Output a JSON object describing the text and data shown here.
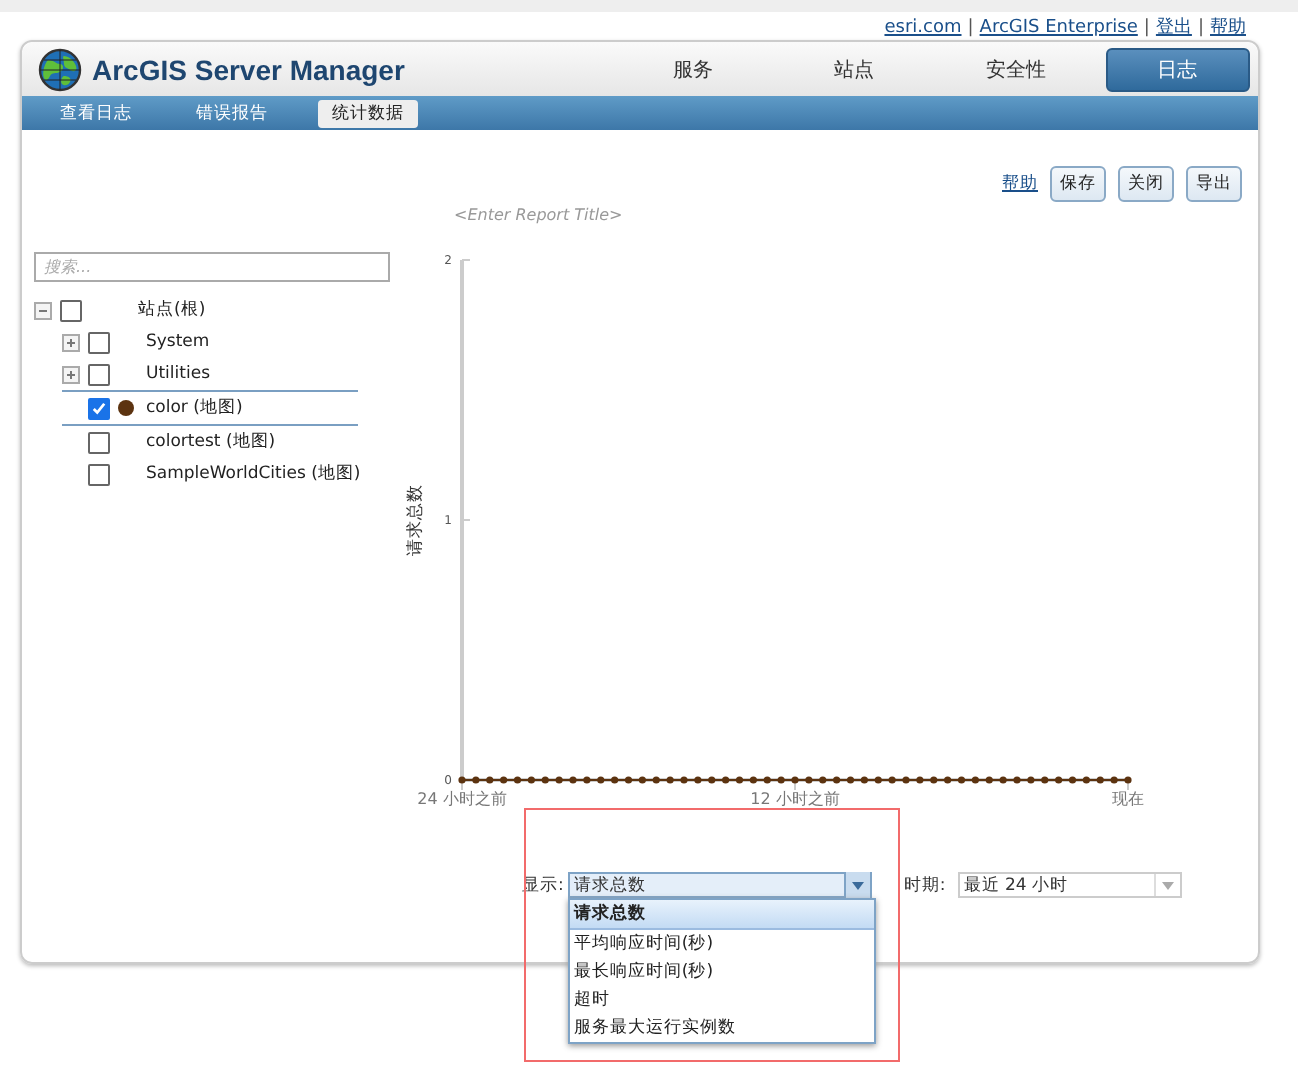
{
  "top_links": [
    "esri.com",
    "ArcGIS Enterprise",
    "登出",
    "帮助"
  ],
  "top_link_separators": [
    "|",
    "|",
    "|"
  ],
  "header": {
    "title": "ArcGIS Server Manager",
    "nav": [
      {
        "label": "服务",
        "selected": false
      },
      {
        "label": "站点",
        "selected": false
      },
      {
        "label": "安全性",
        "selected": false
      },
      {
        "label": "日志",
        "selected": true
      }
    ]
  },
  "subnav": [
    {
      "label": "查看日志",
      "selected": false
    },
    {
      "label": "错误报告",
      "selected": false
    },
    {
      "label": "统计数据",
      "selected": true
    }
  ],
  "toolbar": {
    "help": "帮助",
    "buttons": [
      "保存",
      "关闭",
      "导出"
    ]
  },
  "search": {
    "placeholder": "搜索..."
  },
  "tree": [
    {
      "label": "站点(根)",
      "checked": false,
      "expanded": true,
      "children": [
        {
          "label": "System",
          "checked": false,
          "expanded": false,
          "selected": false
        },
        {
          "label": "Utilities",
          "checked": false,
          "expanded": false,
          "selected": false
        },
        {
          "label": "color (地图)",
          "checked": true,
          "selected": true,
          "color": "#5c3310"
        },
        {
          "label": "colortest (地图)",
          "checked": false,
          "selected": false
        },
        {
          "label": "SampleWorldCities (地图)",
          "checked": false,
          "selected": false
        }
      ]
    }
  ],
  "report_title": {
    "placeholder": "<Enter Report Title>"
  },
  "chart": {
    "chart_data": {
      "type": "line",
      "ylabel": "请求总数",
      "ylim": [
        0,
        2
      ],
      "yticks": [
        0,
        1,
        2
      ],
      "xlim": [
        -24,
        0
      ],
      "xticks": [
        {
          "value": -24,
          "label": "24 小时之前"
        },
        {
          "value": -12,
          "label": "12 小时之前"
        },
        {
          "value": 0,
          "label": "现在"
        }
      ],
      "x": [
        -24,
        -23.5,
        -23,
        -22.5,
        -22,
        -21.5,
        -21,
        -20.5,
        -20,
        -19.5,
        -19,
        -18.5,
        -18,
        -17.5,
        -17,
        -16.5,
        -16,
        -15.5,
        -15,
        -14.5,
        -14,
        -13.5,
        -13,
        -12.5,
        -12,
        -11.5,
        -11,
        -10.5,
        -10,
        -9.5,
        -9,
        -8.5,
        -8,
        -7.5,
        -7,
        -6.5,
        -6,
        -5.5,
        -5,
        -4.5,
        -4,
        -3.5,
        -3,
        -2.5,
        -2,
        -1.5,
        -1,
        -0.5,
        0
      ],
      "series": [
        {
          "color": "#5c3310",
          "marker": "circle",
          "values": [
            0,
            0,
            0,
            0,
            0,
            0,
            0,
            0,
            0,
            0,
            0,
            0,
            0,
            0,
            0,
            0,
            0,
            0,
            0,
            0,
            0,
            0,
            0,
            0,
            0,
            0,
            0,
            0,
            0,
            0,
            0,
            0,
            0,
            0,
            0,
            0,
            0,
            0,
            0,
            0,
            0,
            0,
            0,
            0,
            0,
            0,
            0,
            0,
            0
          ]
        }
      ]
    }
  },
  "display": {
    "label": "显示:",
    "value": "请求总数",
    "options": [
      {
        "label": "请求总数",
        "selected": true
      },
      {
        "label": "平均响应时间(秒)",
        "selected": false
      },
      {
        "label": "最长响应时间(秒)",
        "selected": false
      },
      {
        "label": "超时",
        "selected": false
      },
      {
        "label": "服务最大运行实例数",
        "selected": false
      }
    ]
  },
  "period": {
    "label": "时期:",
    "value": "最近 24 小时"
  }
}
